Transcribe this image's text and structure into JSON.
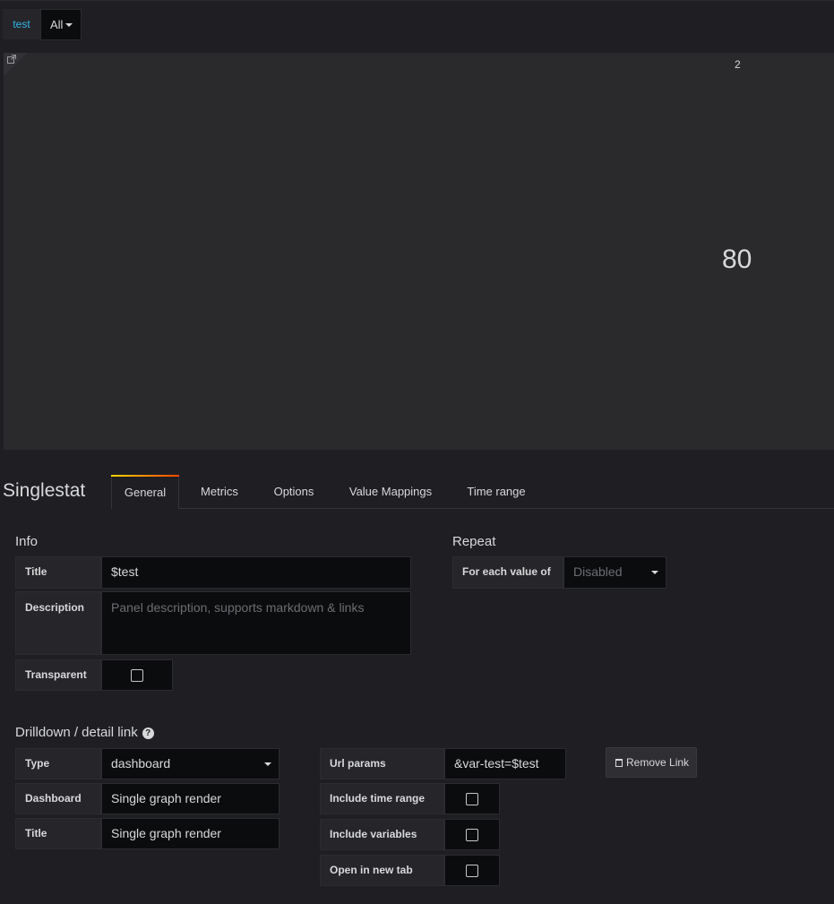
{
  "variables": {
    "label": "test",
    "selected": "All"
  },
  "panel": {
    "title": "2",
    "value": "80"
  },
  "editor": {
    "title": "Singlestat",
    "tabs": [
      "General",
      "Metrics",
      "Options",
      "Value Mappings",
      "Time range"
    ],
    "active_tab": "General"
  },
  "info": {
    "heading": "Info",
    "title_label": "Title",
    "title_value": "$test",
    "description_label": "Description",
    "description_placeholder": "Panel description, supports markdown & links",
    "transparent_label": "Transparent",
    "transparent_checked": false
  },
  "repeat": {
    "heading": "Repeat",
    "label": "For each value of",
    "value": "Disabled"
  },
  "drilldown": {
    "heading": "Drilldown / detail link",
    "type_label": "Type",
    "type_value": "dashboard",
    "dashboard_label": "Dashboard",
    "dashboard_value": "Single graph render",
    "title_label": "Title",
    "title_value": "Single graph render",
    "url_params_label": "Url params",
    "url_params_value": "&var-test=$test",
    "include_time_label": "Include time range",
    "include_vars_label": "Include variables",
    "new_tab_label": "Open in new tab",
    "remove_label": "Remove Link"
  },
  "icons": {
    "help": "question-circle-icon",
    "remove": "trash-icon",
    "link": "external-link-icon"
  }
}
